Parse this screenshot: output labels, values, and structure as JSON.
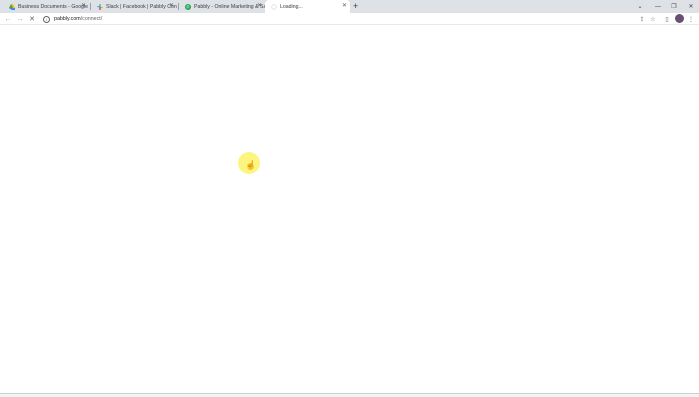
{
  "tabs": [
    {
      "title": "Business Documents - Google D",
      "icon": "google-drive-icon",
      "active": false
    },
    {
      "title": "Slack | Facebook | Pabbly Connect",
      "icon": "slack-icon",
      "active": false
    },
    {
      "title": "Pabbly - Online Marketing & Sal",
      "icon": "pabbly-icon",
      "active": false
    },
    {
      "title": "Loading...",
      "icon": "loading-icon",
      "active": true
    }
  ],
  "new_tab_label": "+",
  "address_bar": {
    "domain": "pabbly.com",
    "path": "/connect/"
  },
  "colors": {
    "accent_yellow": "#fbf36a",
    "tabstrip": "#dee1e6",
    "avatar": "#6b4f72"
  }
}
